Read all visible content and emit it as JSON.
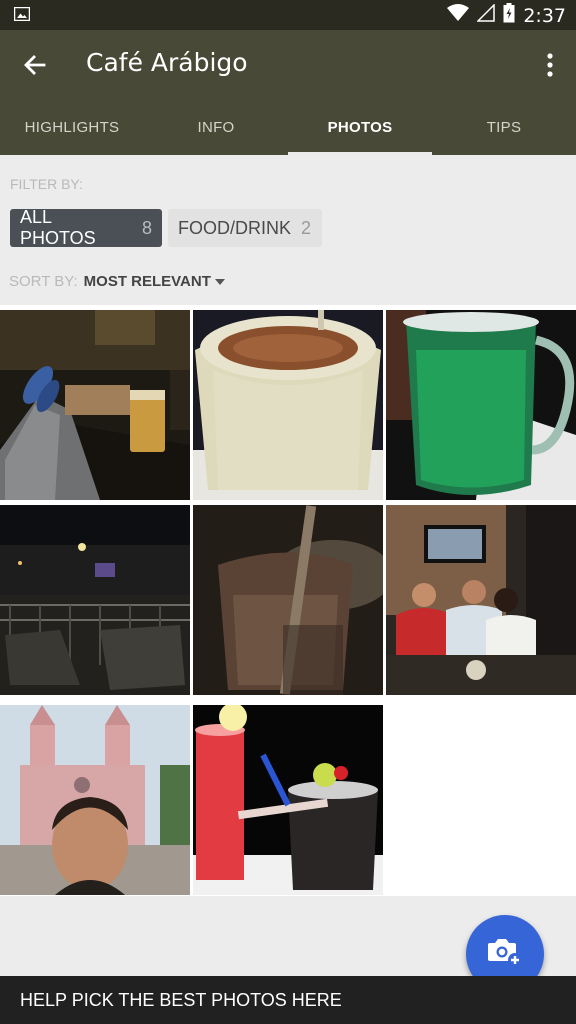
{
  "status_bar": {
    "time": "2:37",
    "icons": [
      "image-icon",
      "wifi-icon",
      "signal-icon",
      "battery-icon"
    ]
  },
  "app_bar": {
    "title": "Café Arábigo",
    "back_icon": "arrow-back-icon",
    "menu_icon": "more-vert-icon"
  },
  "tabs": [
    {
      "label": "HIGHLIGHTS",
      "active": false
    },
    {
      "label": "INFO",
      "active": false
    },
    {
      "label": "PHOTOS",
      "active": true
    },
    {
      "label": "TIPS",
      "active": false
    }
  ],
  "filter": {
    "label": "FILTER BY:",
    "chips": [
      {
        "label": "ALL PHOTOS",
        "count": "8",
        "selected": true
      },
      {
        "label": "FOOD/DRINK",
        "count": "2",
        "selected": false
      }
    ]
  },
  "sort": {
    "label": "SORT BY:",
    "value": "MOST RELEVANT"
  },
  "photos": [
    {
      "subject": "legs-and-beer-photo"
    },
    {
      "subject": "frappe-drink-photo"
    },
    {
      "subject": "green-drink-mug-photo"
    },
    {
      "subject": "night-terrace-photo"
    },
    {
      "subject": "blurry-glass-photo"
    },
    {
      "subject": "friends-group-photo"
    },
    {
      "subject": "church-selfie-photo"
    },
    {
      "subject": "red-and-dark-drinks-photo"
    }
  ],
  "fab": {
    "icon": "add-photo-camera-icon"
  },
  "bottom_bar": {
    "label": "HELP PICK THE BEST PHOTOS HERE"
  },
  "colors": {
    "app_bar": "#484936",
    "status_bar": "#2b2a21",
    "chip_selected": "#4a5056",
    "fab": "#3565d6"
  }
}
